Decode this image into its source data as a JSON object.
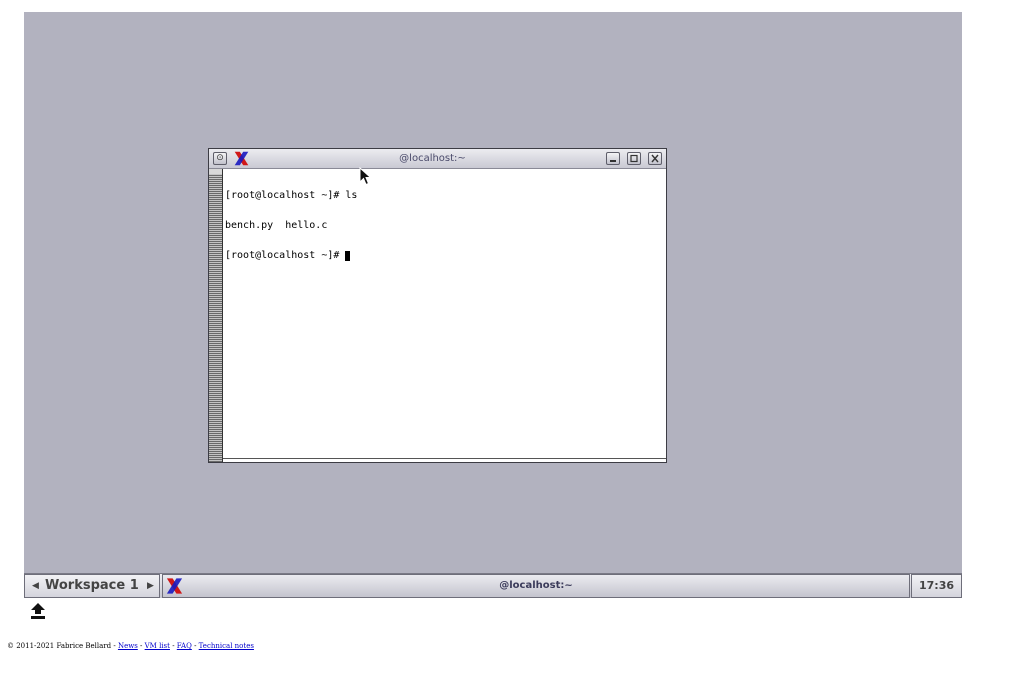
{
  "terminal": {
    "title": "@localhost:~",
    "lines": [
      "[root@localhost ~]# ls",
      "bench.py  hello.c",
      "[root@localhost ~]# "
    ]
  },
  "window_buttons": {
    "menu": "menu-icon",
    "minimize": "minimize-icon",
    "maximize": "maximize-icon",
    "close": "close-icon"
  },
  "taskbar": {
    "workspace_label": "Workspace 1",
    "prev_arrow": "◀",
    "next_arrow": "▶",
    "task_label": "@localhost:~",
    "clock": "17:36"
  },
  "footer": {
    "copyright": "© 2011-2021 Fabrice Bellard - ",
    "links": [
      "News",
      "VM list",
      "FAQ",
      "Technical notes"
    ],
    "separator": " - "
  },
  "colors": {
    "desktop": "#b2b2bf",
    "link": "#0000cc",
    "xlogo_red": "#d01818",
    "xlogo_blue": "#1818c0"
  }
}
